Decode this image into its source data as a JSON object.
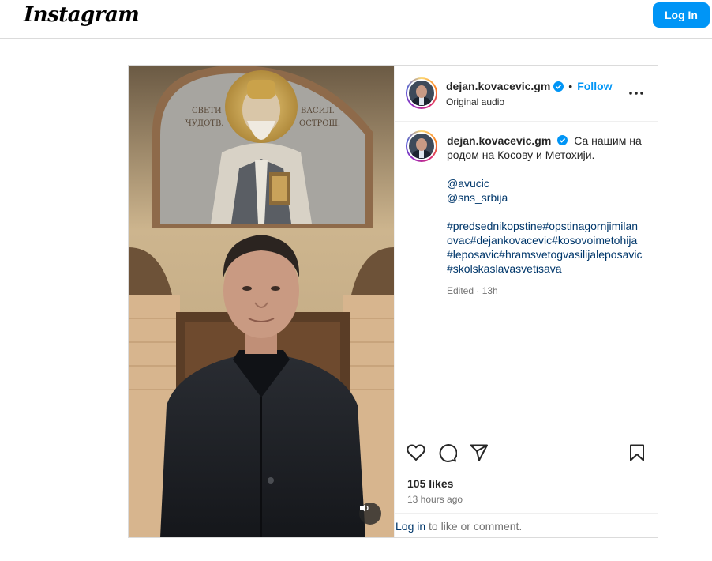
{
  "header": {
    "logo": "Instagram",
    "login_label": "Log In"
  },
  "post": {
    "author": {
      "username": "dejan.kovacevic.gm",
      "verified": true,
      "follow_label": "Follow",
      "dot": "•"
    },
    "audio_label": "Original audio",
    "caption": {
      "username": "dejan.kovacevic.gm",
      "text": "Са нашим народом на Косову и Метохији.",
      "mentions": [
        "@avucic",
        "@sns_srbija"
      ],
      "hashtags": "#predsednikopstine#opstinagornjimilanovac#dejankovacevic#kosovoimetohija#leposavic#hramsvetogvasilijaleposavic#skolskaslavasvetisava",
      "meta": "Edited · 13h"
    },
    "likes": "105 likes",
    "time_ago": "13 hours ago",
    "comment_prompt": {
      "login_link": "Log in",
      "rest": " to like or comment."
    },
    "icons": {
      "like": "heart-icon",
      "comment": "comment-icon",
      "share": "share-icon",
      "save": "bookmark-icon",
      "more": "more-options-icon",
      "sound": "volume-icon"
    },
    "colors": {
      "accent": "#0095f6",
      "link": "#00376b",
      "verified": "#0095f6",
      "muted": "#737373"
    }
  }
}
